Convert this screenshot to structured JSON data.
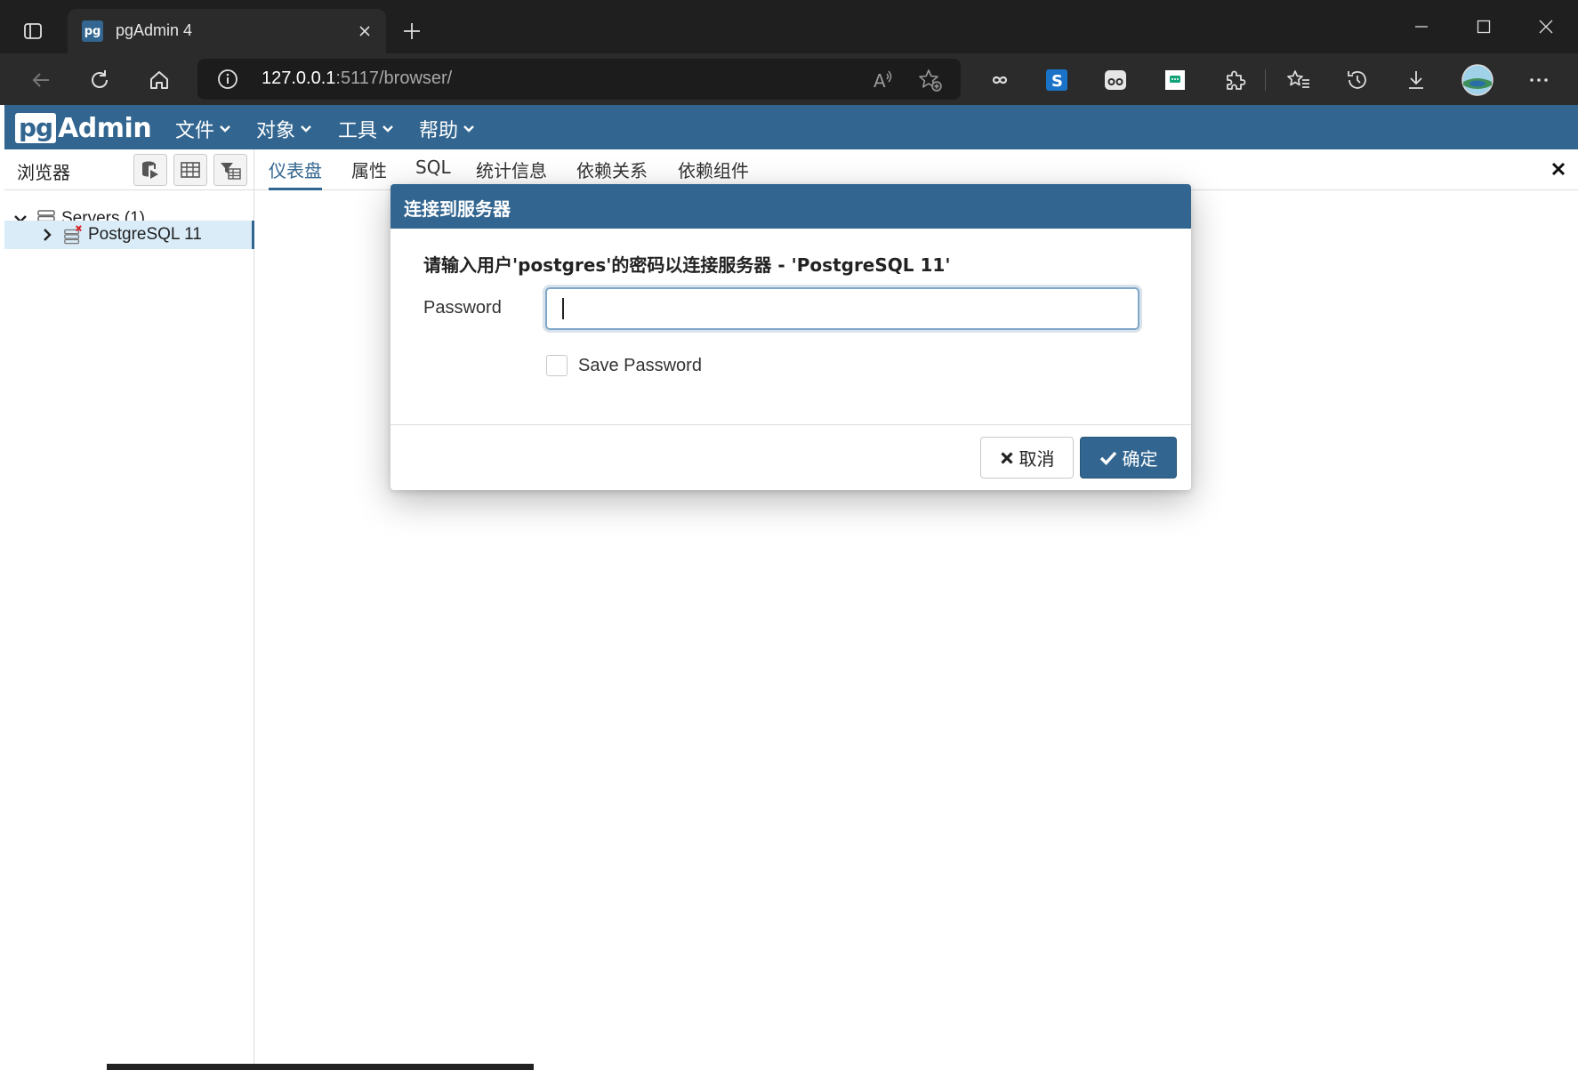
{
  "browser": {
    "tab_title": "pgAdmin 4",
    "tab_favicon": "pg",
    "url_host": "127.0.0.1",
    "url_rest": ":5117/browser/"
  },
  "pgadmin": {
    "logo_box": "pg",
    "logo_text": "Admin",
    "menus": [
      "文件",
      "对象",
      "工具",
      "帮助"
    ],
    "browser_panel": {
      "title": "浏览器",
      "tree": [
        {
          "label": "Servers (1)",
          "expanded": true
        },
        {
          "label": "PostgreSQL 11",
          "expanded": false,
          "selected": true,
          "disconnected": true
        }
      ]
    },
    "main_tabs": [
      "仪表盘",
      "属性",
      "SQL",
      "统计信息",
      "依赖关系",
      "依赖组件"
    ],
    "active_tab": "仪表盘"
  },
  "dialog": {
    "title": "连接到服务器",
    "message": "请输入用户'postgres'的密码以连接服务器 - 'PostgreSQL 11'",
    "password_label": "Password",
    "password_value": "",
    "save_password_label": "Save Password",
    "save_password_checked": false,
    "cancel_label": "取消",
    "ok_label": "确定"
  },
  "colors": {
    "brand": "#326690",
    "chrome_dark": "#1f1f1f",
    "selection": "#d9ecf8"
  }
}
